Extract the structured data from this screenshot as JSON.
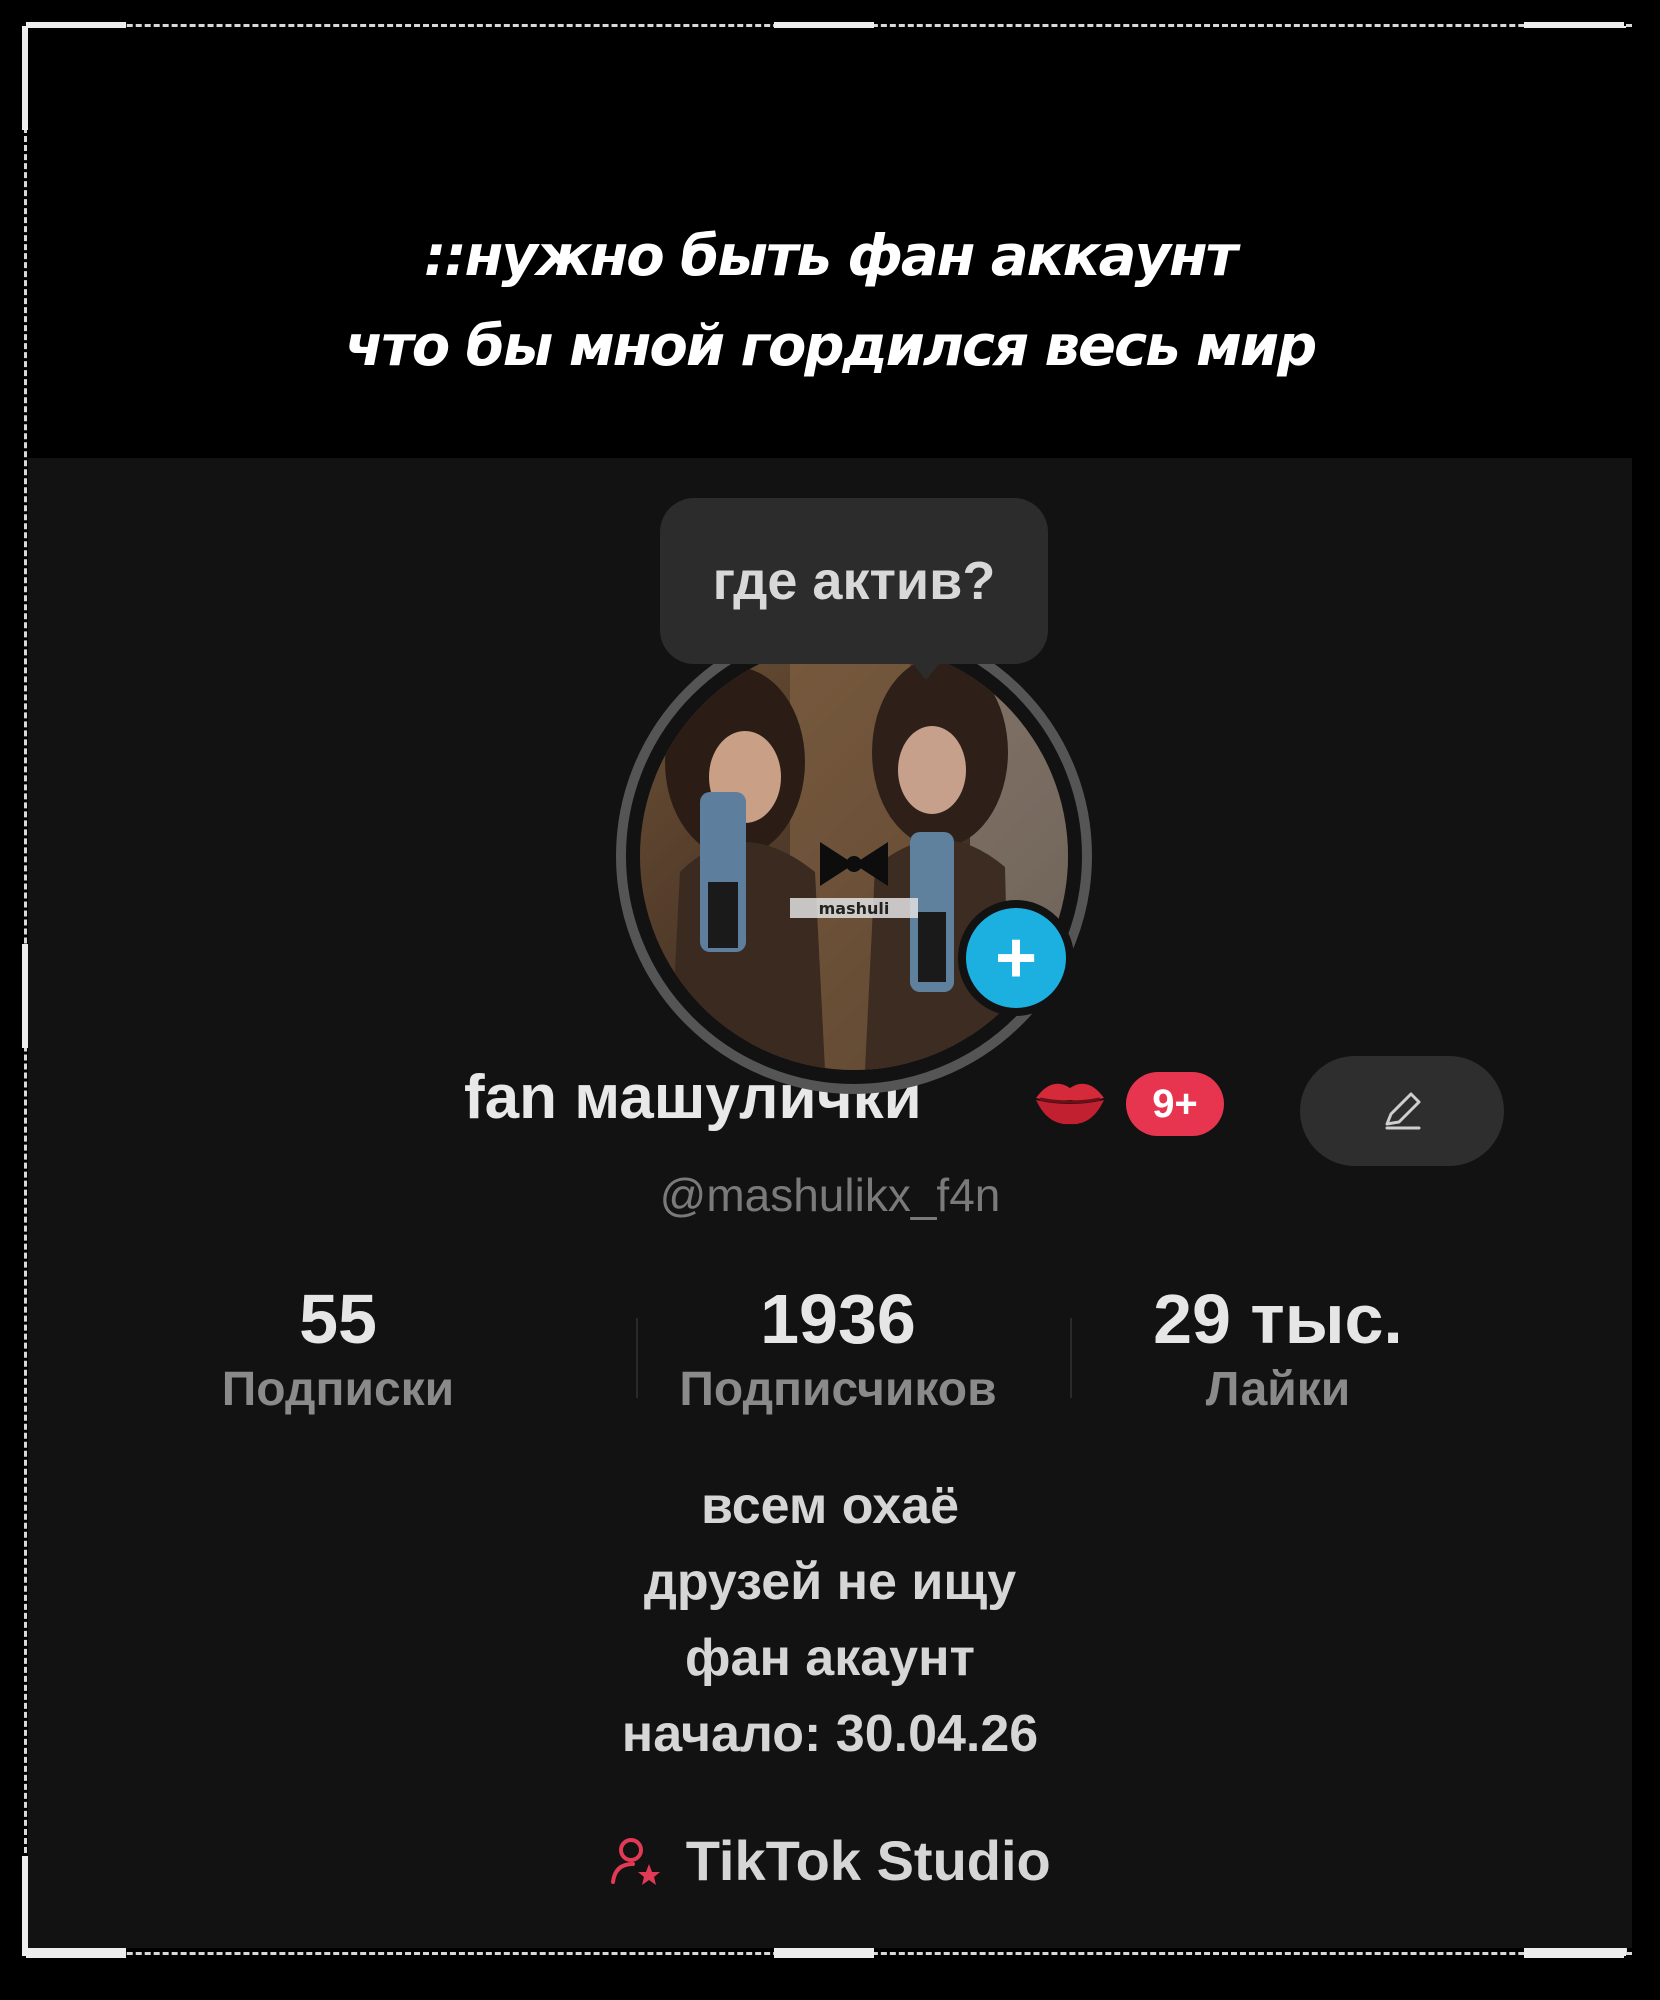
{
  "caption": {
    "line1": "::нужно быть фан аккаунт",
    "line2": "что бы мной гордился весь мир"
  },
  "profile": {
    "note_bubble": "где актив?",
    "display_name": "fan машулички",
    "notification_badge": "9+",
    "username": "@mashulikx_f4n",
    "avatar_watermark": "mashuli",
    "stats": [
      {
        "value": "55",
        "label": "Подписки"
      },
      {
        "value": "1936",
        "label": "Подписчиков"
      },
      {
        "value": "29 тыс.",
        "label": "Лайки"
      }
    ],
    "bio": [
      "всем охаё",
      "друзей не ищу",
      "фан акаунт",
      "начало: 30.04.26"
    ],
    "studio_label": "TikTok Studio"
  },
  "icons": {
    "add": "plus-icon",
    "edit": "pencil-icon",
    "emoji": "kiss-lips-icon",
    "studio": "user-star-icon"
  },
  "colors": {
    "accent_blue": "#1cb0e0",
    "badge_red": "#e8354f",
    "background": "#121212"
  }
}
